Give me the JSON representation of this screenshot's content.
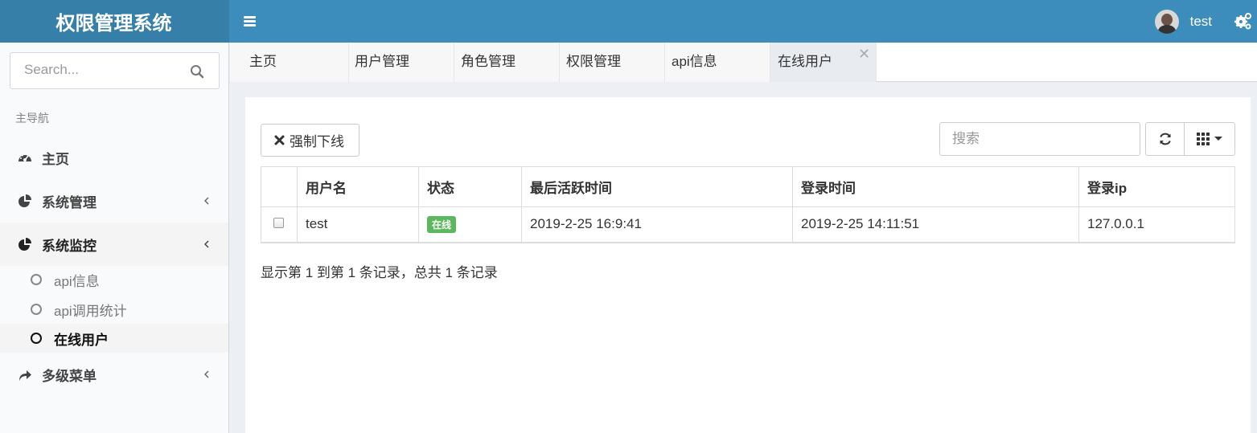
{
  "app": {
    "title": "权限管理系统"
  },
  "header": {
    "username": "test"
  },
  "sidebar": {
    "search_placeholder": "Search...",
    "nav_header": "主导航",
    "items": [
      {
        "label": "主页",
        "icon": "dashboard-icon"
      },
      {
        "label": "系统管理",
        "icon": "pie-chart-icon"
      },
      {
        "label": "系统监控",
        "icon": "pie-chart-icon"
      },
      {
        "label": "多级菜单",
        "icon": "share-icon"
      }
    ],
    "sub_items": [
      {
        "label": "api信息"
      },
      {
        "label": "api调用统计"
      },
      {
        "label": "在线用户"
      }
    ]
  },
  "tabs": [
    {
      "label": "主页"
    },
    {
      "label": "用户管理"
    },
    {
      "label": "角色管理"
    },
    {
      "label": "权限管理"
    },
    {
      "label": "api信息"
    },
    {
      "label": "在线用户"
    }
  ],
  "toolbar": {
    "kick_label": "强制下线",
    "search_placeholder": "搜索"
  },
  "table": {
    "columns": [
      "用户名",
      "状态",
      "最后活跃时间",
      "登录时间",
      "登录ip"
    ],
    "rows": [
      {
        "username": "test",
        "status": "在线",
        "last_active": "2019-2-25 16:9:41",
        "login_time": "2019-2-25 14:11:51",
        "ip": "127.0.0.1"
      }
    ]
  },
  "pagination": {
    "info": "显示第 1 到第 1 条记录，总共 1 条记录"
  },
  "colors": {
    "header": "#3c8dbc",
    "logo": "#367fa9",
    "success": "#5cb85c"
  }
}
